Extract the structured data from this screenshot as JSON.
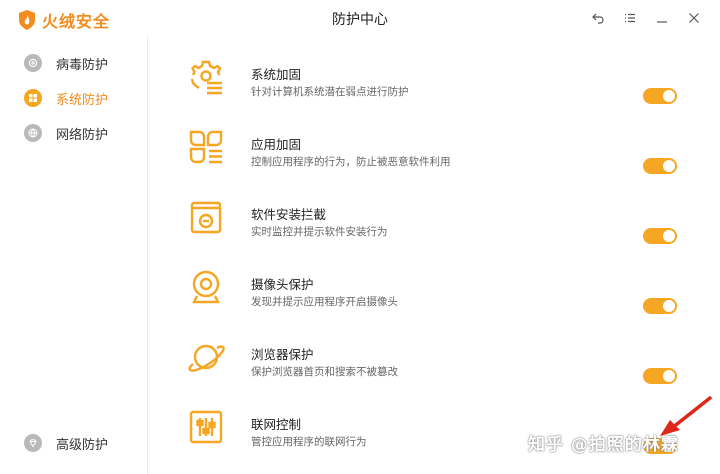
{
  "app": {
    "brand": "火绒安全",
    "window_title": "防护中心"
  },
  "window_buttons": [
    {
      "name": "back-icon"
    },
    {
      "name": "menu-icon"
    },
    {
      "name": "minimize-icon"
    },
    {
      "name": "close-icon"
    }
  ],
  "sidebar": {
    "items": [
      {
        "label": "病毒防护",
        "icon": "plus-shield-icon",
        "active": false
      },
      {
        "label": "系统防护",
        "icon": "windows-icon",
        "active": true
      },
      {
        "label": "网络防护",
        "icon": "globe-icon",
        "active": false
      }
    ],
    "bottom_item": {
      "label": "高级防护",
      "icon": "gem-icon"
    }
  },
  "rows": [
    {
      "title": "系统加固",
      "desc": "针对计算机系统潜在弱点进行防护",
      "icon": "gear-list-icon",
      "enabled": true
    },
    {
      "title": "应用加固",
      "desc": "控制应用程序的行为，防止被恶意软件利用",
      "icon": "app-grid-icon",
      "enabled": true
    },
    {
      "title": "软件安装拦截",
      "desc": "实时监控并提示软件安装行为",
      "icon": "install-box-icon",
      "enabled": true
    },
    {
      "title": "摄像头保护",
      "desc": "发现并提示应用程序开启摄像头",
      "icon": "camera-icon",
      "enabled": true
    },
    {
      "title": "浏览器保护",
      "desc": "保护浏览器首页和搜索不被篡改",
      "icon": "planet-icon",
      "enabled": true
    },
    {
      "title": "联网控制",
      "desc": "管控应用程序的联网行为",
      "icon": "sliders-icon",
      "enabled": true
    }
  ],
  "overlay": {
    "watermark": "知乎 @拍照的林霖"
  },
  "colors": {
    "accent": "#f5a623",
    "brand": "#f28c1f",
    "inactive_icon": "#b9b9b9",
    "annotation_arrow": "#e0261b"
  }
}
